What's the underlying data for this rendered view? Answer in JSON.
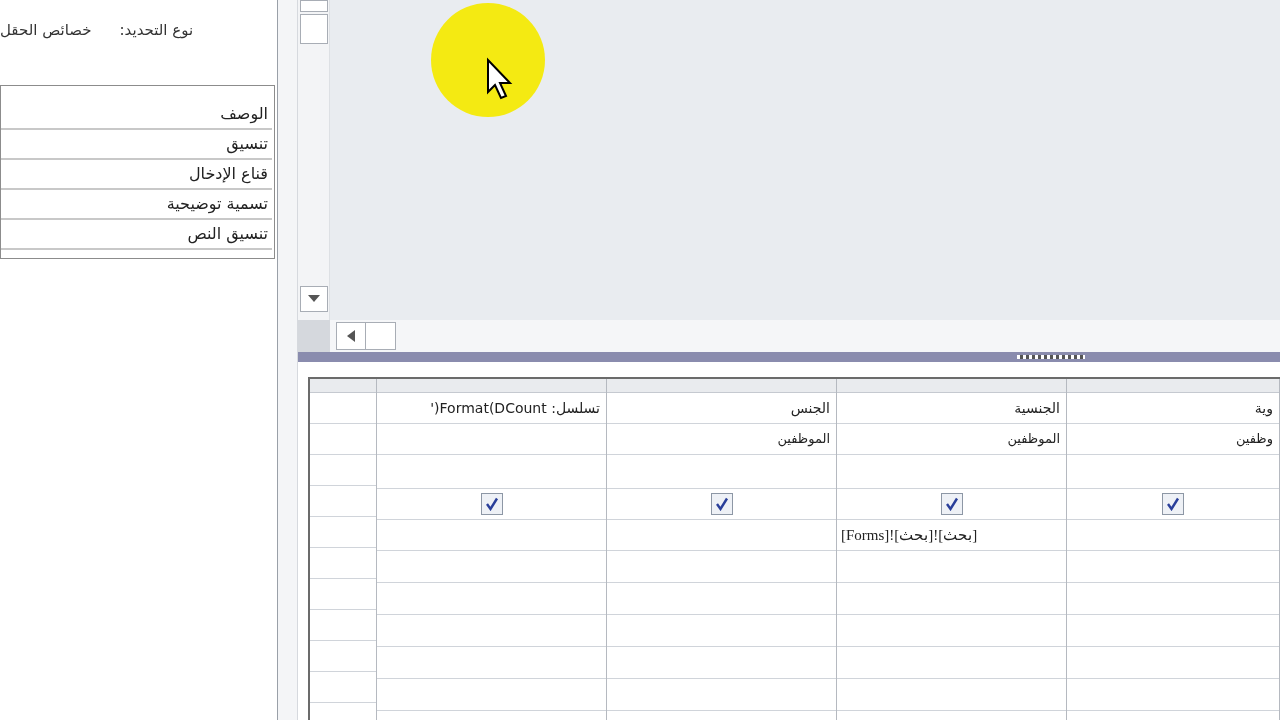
{
  "selection_type": {
    "label": "نوع التحديد:",
    "value": "خصائص الحقل"
  },
  "properties": [
    "الوصف",
    "تنسيق",
    "قناع الإدخال",
    "تسمية توضيحية",
    "تنسيق النص"
  ],
  "grid": {
    "columns": [
      {
        "field": "وية",
        "table": "وظفين",
        "show": true
      },
      {
        "field": "الجنسية",
        "table": "الموظفين",
        "show": true,
        "criteria": "[بحث]![بحث]![Forms]"
      },
      {
        "field": "الجنس",
        "table": "الموظفين",
        "show": true
      },
      {
        "field": "تسلسل: Format(DCount('",
        "show": true
      }
    ]
  }
}
